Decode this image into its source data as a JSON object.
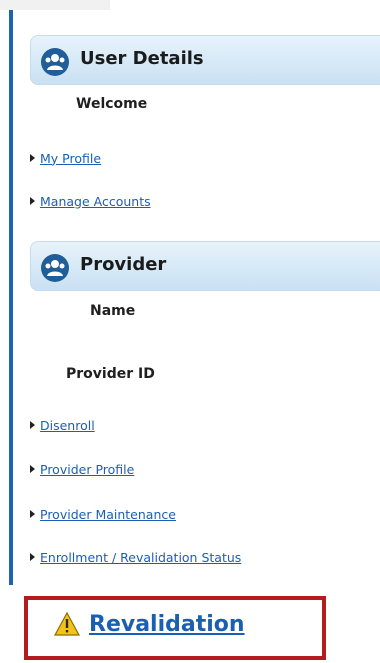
{
  "user_details": {
    "title": "User Details",
    "welcome": "Welcome",
    "links": [
      {
        "label": "My Profile"
      },
      {
        "label": "Manage Accounts"
      }
    ]
  },
  "provider": {
    "title": "Provider",
    "name_label": "Name",
    "id_label": "Provider ID",
    "links": [
      {
        "label": "Disenroll"
      },
      {
        "label": "Provider Profile"
      },
      {
        "label": "Provider Maintenance"
      },
      {
        "label": "Enrollment / Revalidation Status"
      }
    ]
  },
  "revalidation": {
    "label": "Revalidation"
  },
  "colors": {
    "accent_blue": "#1c64ad",
    "link_blue": "#1a5fb4",
    "highlight_red": "#b31b1f",
    "warning_yellow": "#f3c317"
  },
  "icons": {
    "section": "users-group-icon",
    "revalidation": "warning-triangle-icon"
  }
}
